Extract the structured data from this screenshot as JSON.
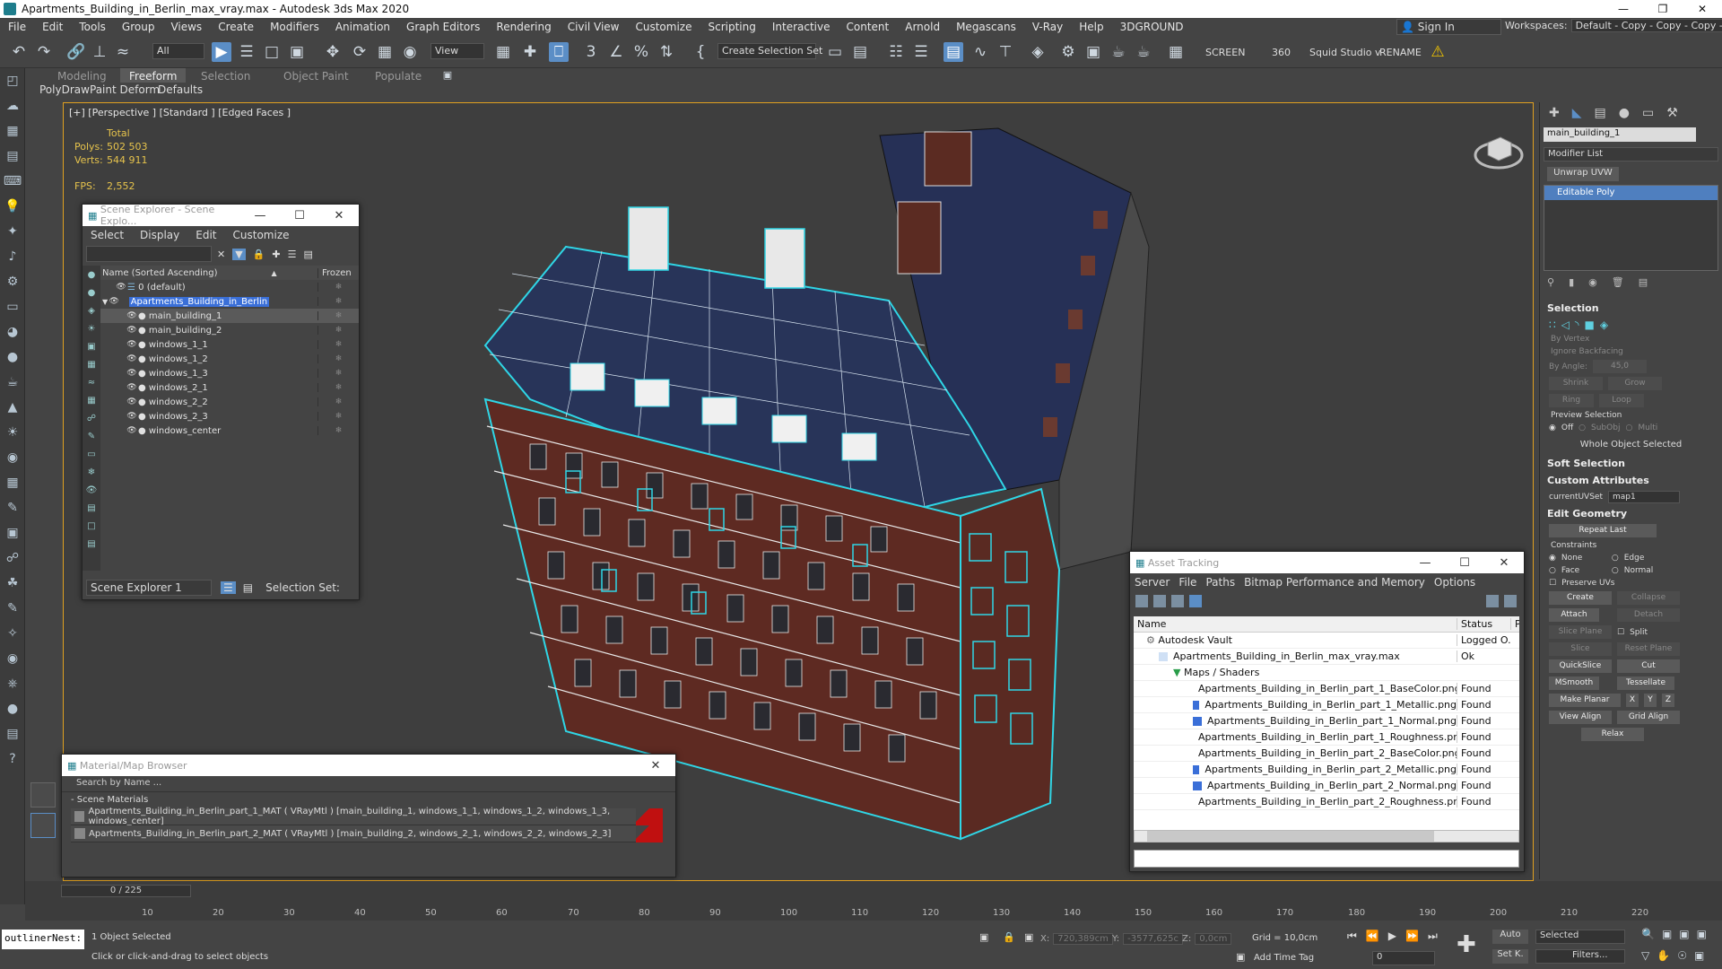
{
  "window": {
    "title": "Apartments_Building_in_Berlin_max_vray.max - Autodesk 3ds Max 2020"
  },
  "menu": [
    "File",
    "Edit",
    "Tools",
    "Group",
    "Views",
    "Create",
    "Modifiers",
    "Animation",
    "Graph Editors",
    "Rendering",
    "Civil View",
    "Customize",
    "Scripting",
    "Interactive",
    "Content",
    "Arnold",
    "Megascans",
    "V-Ray",
    "Help",
    "3DGROUND"
  ],
  "signin": "Sign In",
  "workspaces": {
    "label": "Workspaces:",
    "value": "Default - Copy - Copy - Copy - Copy"
  },
  "toolbar": {
    "filter": "All",
    "refcoord": "View",
    "selset": "Create Selection Set",
    "screen": "SCREEN",
    "num360": "360",
    "squid": "Squid Studio v",
    "rename": "RENAME"
  },
  "ribbon": {
    "tabs": [
      "Modeling",
      "Freeform",
      "Selection",
      "Object Paint",
      "Populate"
    ],
    "sub": [
      "PolyDraw",
      "Paint Deform",
      "Defaults"
    ]
  },
  "viewport": {
    "label": "[+] [Perspective ] [Standard ] [Edged Faces ]",
    "stats": {
      "total": "Total",
      "polys_label": "Polys:",
      "polys": "502 503",
      "verts_label": "Verts:",
      "verts": "544 911",
      "fps_label": "FPS:",
      "fps": "2,552"
    }
  },
  "scene_explorer": {
    "title": "Scene Explorer - Scene Explo...",
    "menu": [
      "Select",
      "Display",
      "Edit",
      "Customize"
    ],
    "col_name": "Name (Sorted Ascending)",
    "col_frozen": "Frozen",
    "rows": [
      "0 (default)",
      "Apartments_Building_in_Berlin",
      "main_building_1",
      "main_building_2",
      "windows_1_1",
      "windows_1_2",
      "windows_1_3",
      "windows_2_1",
      "windows_2_2",
      "windows_2_3",
      "windows_center"
    ],
    "footer": "Scene Explorer 1",
    "selset": "Selection Set:"
  },
  "material_browser": {
    "title": "Material/Map Browser",
    "search": "Search by Name ...",
    "group": "- Scene Materials",
    "rows": [
      "Apartments_Building_in_Berlin_part_1_MAT  ( VRayMtl )  [main_building_1, windows_1_1, windows_1_2, windows_1_3, windows_center]",
      "Apartments_Building_in_Berlin_part_2_MAT  ( VRayMtl )  [main_building_2, windows_2_1, windows_2_2, windows_2_3]"
    ]
  },
  "asset_tracking": {
    "title": "Asset Tracking",
    "menu": [
      "Server",
      "File",
      "Paths",
      "Bitmap Performance and Memory",
      "Options"
    ],
    "col_name": "Name",
    "col_status": "Status",
    "col_extra": "P",
    "rows": [
      {
        "name": "Autodesk Vault",
        "status": "Logged O..."
      },
      {
        "name": "Apartments_Building_in_Berlin_max_vray.max",
        "status": "Ok"
      },
      {
        "name": "Maps / Shaders",
        "status": ""
      },
      {
        "name": "Apartments_Building_in_Berlin_part_1_BaseColor.png",
        "status": "Found"
      },
      {
        "name": "Apartments_Building_in_Berlin_part_1_Metallic.png",
        "status": "Found"
      },
      {
        "name": "Apartments_Building_in_Berlin_part_1_Normal.png",
        "status": "Found"
      },
      {
        "name": "Apartments_Building_in_Berlin_part_1_Roughness.png",
        "status": "Found"
      },
      {
        "name": "Apartments_Building_in_Berlin_part_2_BaseColor.png",
        "status": "Found"
      },
      {
        "name": "Apartments_Building_in_Berlin_part_2_Metallic.png",
        "status": "Found"
      },
      {
        "name": "Apartments_Building_in_Berlin_part_2_Normal.png",
        "status": "Found"
      },
      {
        "name": "Apartments_Building_in_Berlin_part_2_Roughness.png",
        "status": "Found"
      }
    ]
  },
  "command_panel": {
    "object_name": "main_building_1",
    "modifier_list": "Modifier List",
    "unwrap": "Unwrap UVW",
    "stack_item": "Editable Poly",
    "selection": {
      "title": "Selection",
      "by_vertex": "By Vertex",
      "ignore_backfacing": "Ignore Backfacing",
      "by_angle": "By Angle:",
      "angle": "45,0",
      "shrink": "Shrink",
      "grow": "Grow",
      "ring": "Ring",
      "loop": "Loop",
      "preview": "Preview Selection",
      "off": "Off",
      "subobj": "SubObj",
      "multi": "Multi",
      "whole": "Whole Object Selected"
    },
    "soft_selection": "Soft Selection",
    "custom_attributes": {
      "title": "Custom Attributes",
      "label": "currentUVSet",
      "value": "map1"
    },
    "edit_geometry": {
      "title": "Edit Geometry",
      "repeat_last": "Repeat Last",
      "constraints": "Constraints",
      "none": "None",
      "edge": "Edge",
      "face": "Face",
      "normal": "Normal",
      "preserve": "Preserve UVs",
      "create": "Create",
      "collapse": "Collapse",
      "attach": "Attach",
      "detach": "Detach",
      "slice_plane": "Slice Plane",
      "split": "Split",
      "slice": "Slice",
      "reset_plane": "Reset Plane",
      "quickslice": "QuickSlice",
      "cut": "Cut",
      "msmooth": "MSmooth",
      "tessellate": "Tessellate",
      "make_planar": "Make Planar",
      "x": "X",
      "y": "Y",
      "z": "Z",
      "view_align": "View Align",
      "grid_align": "Grid Align",
      "relax": "Relax"
    }
  },
  "timeline": {
    "frame": "0 / 225",
    "ticks": [
      "10",
      "20",
      "30",
      "40",
      "50",
      "60",
      "70",
      "80",
      "90",
      "100",
      "110",
      "120",
      "130",
      "140",
      "150",
      "160",
      "170",
      "180",
      "190",
      "200",
      "210",
      "220"
    ]
  },
  "status": {
    "listener": "outlinerNest:",
    "selected": "1 Object Selected",
    "prompt": "Click or click-and-drag to select objects",
    "x_label": "X:",
    "x": "720,389cm",
    "y_label": "Y:",
    "y": "-3577,625c",
    "z_label": "Z:",
    "z": "0,0cm",
    "grid": "Grid = 10,0cm",
    "add_time_tag": "Add Time Tag",
    "auto": "Auto",
    "selected_mode": "Selected",
    "setk": "Set K.",
    "filters": "Filters...",
    "frame_val": "0"
  },
  "colors": {
    "accent": "#5b8ec6",
    "selection": "#2fd6e6",
    "viewport_border": "#e0a020",
    "roof": "#283459",
    "brick": "#6b2f24"
  }
}
